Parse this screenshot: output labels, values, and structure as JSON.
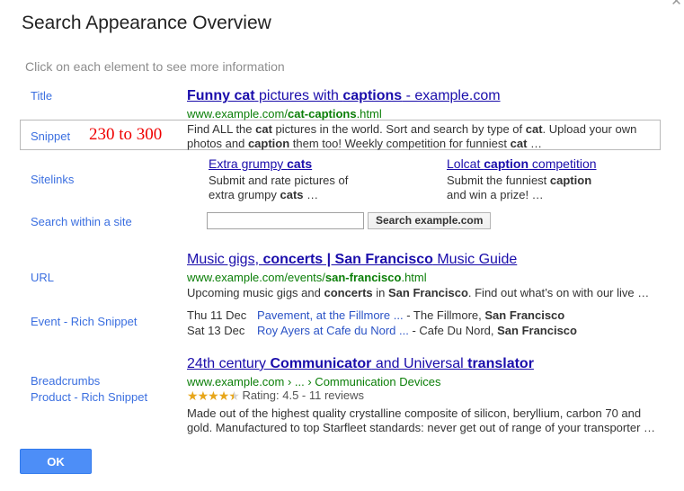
{
  "dialog": {
    "title": "Search Appearance Overview",
    "subtitle": "Click on each element to see more information",
    "close_icon": "close-icon",
    "ok_label": "OK"
  },
  "labels": {
    "title": "Title",
    "snippet": "Snippet",
    "sitelinks": "Sitelinks",
    "search_within_site": "Search within a site",
    "url": "URL",
    "event_rich_snippet": "Event - Rich Snippet",
    "breadcrumbs": "Breadcrumbs",
    "product_rich_snippet": "Product - Rich Snippet"
  },
  "snippet_range": "230 to 300",
  "result_one": {
    "title_parts": [
      {
        "text": "Funny cat",
        "bold": true
      },
      {
        "text": " pictures with ",
        "bold": false
      },
      {
        "text": "captions",
        "bold": true
      },
      {
        "text": " - example.com",
        "bold": false
      }
    ],
    "url_parts": [
      {
        "text": "www.example.com/",
        "bold": false
      },
      {
        "text": "cat-captions",
        "bold": true
      },
      {
        "text": ".html",
        "bold": false
      }
    ],
    "description_parts": [
      {
        "text": "Find ALL the ",
        "bold": false
      },
      {
        "text": "cat",
        "bold": true
      },
      {
        "text": " pictures in the world. Sort and search by type of ",
        "bold": false
      },
      {
        "text": "cat",
        "bold": true
      },
      {
        "text": ". Upload your own photos and ",
        "bold": false
      },
      {
        "text": "caption",
        "bold": true
      },
      {
        "text": " them too! Weekly competition for funniest ",
        "bold": false
      },
      {
        "text": "cat",
        "bold": true
      },
      {
        "text": " …",
        "bold": false
      }
    ]
  },
  "sitelinks": [
    {
      "title_parts": [
        {
          "text": "Extra grumpy ",
          "bold": false
        },
        {
          "text": "cats",
          "bold": true
        }
      ],
      "description_parts": [
        {
          "text": "Submit and rate pictures of extra grumpy ",
          "bold": false
        },
        {
          "text": "cats",
          "bold": true
        },
        {
          "text": " …",
          "bold": false
        }
      ]
    },
    {
      "title_parts": [
        {
          "text": "Lolcat ",
          "bold": false
        },
        {
          "text": "caption",
          "bold": true
        },
        {
          "text": " competition",
          "bold": false
        }
      ],
      "description_parts": [
        {
          "text": "Submit the funniest ",
          "bold": false
        },
        {
          "text": "caption",
          "bold": true
        },
        {
          "text": " and win a prize! …",
          "bold": false
        }
      ]
    }
  ],
  "site_search": {
    "value": "",
    "placeholder": "",
    "button_label": "Search example.com"
  },
  "result_two": {
    "title_parts": [
      {
        "text": "Music gigs, ",
        "bold": false
      },
      {
        "text": "concerts | San Francisco",
        "bold": true
      },
      {
        "text": " Music Guide",
        "bold": false
      }
    ],
    "url_parts": [
      {
        "text": "www.example.com/events/",
        "bold": false
      },
      {
        "text": "san-francisco",
        "bold": true
      },
      {
        "text": ".html",
        "bold": false
      }
    ],
    "description_parts": [
      {
        "text": "Upcoming music gigs and ",
        "bold": false
      },
      {
        "text": "concerts",
        "bold": true
      },
      {
        "text": " in ",
        "bold": false
      },
      {
        "text": "San Francisco",
        "bold": true
      },
      {
        "text": ". Find out what’s on with our live …",
        "bold": false
      }
    ],
    "events": [
      {
        "date": "Thu 11 Dec",
        "link": "Pavement, at the Fillmore ...",
        "venue_parts": [
          {
            "text": " - The Fillmore, ",
            "bold": false
          },
          {
            "text": "San Francisco",
            "bold": true
          }
        ]
      },
      {
        "date": "Sat 13 Dec",
        "link": "Roy Ayers at Cafe du Nord ...",
        "venue_parts": [
          {
            "text": " - Cafe Du Nord, ",
            "bold": false
          },
          {
            "text": "San Francisco",
            "bold": true
          }
        ]
      }
    ]
  },
  "result_three": {
    "title_parts": [
      {
        "text": "24th century ",
        "bold": false
      },
      {
        "text": "Communicator",
        "bold": true
      },
      {
        "text": " and Universal ",
        "bold": false
      },
      {
        "text": "translator",
        "bold": true
      }
    ],
    "breadcrumb_parts": [
      {
        "text": "www.example.com › ... › Communication Devices",
        "bold": false
      }
    ],
    "rating": {
      "stars_filled": 4,
      "stars_half": 1,
      "stars_total": 5,
      "text": "Rating: 4.5 - 11 reviews",
      "value": 4.5,
      "reviews": 11,
      "star_color": "#e7a61a"
    },
    "description_parts": [
      {
        "text": "Made out of the highest quality crystalline composite of silicon, beryllium, carbon 70 and gold. Manufactured to top Starfleet standards: never get out of range of your transporter …",
        "bold": false
      }
    ]
  }
}
